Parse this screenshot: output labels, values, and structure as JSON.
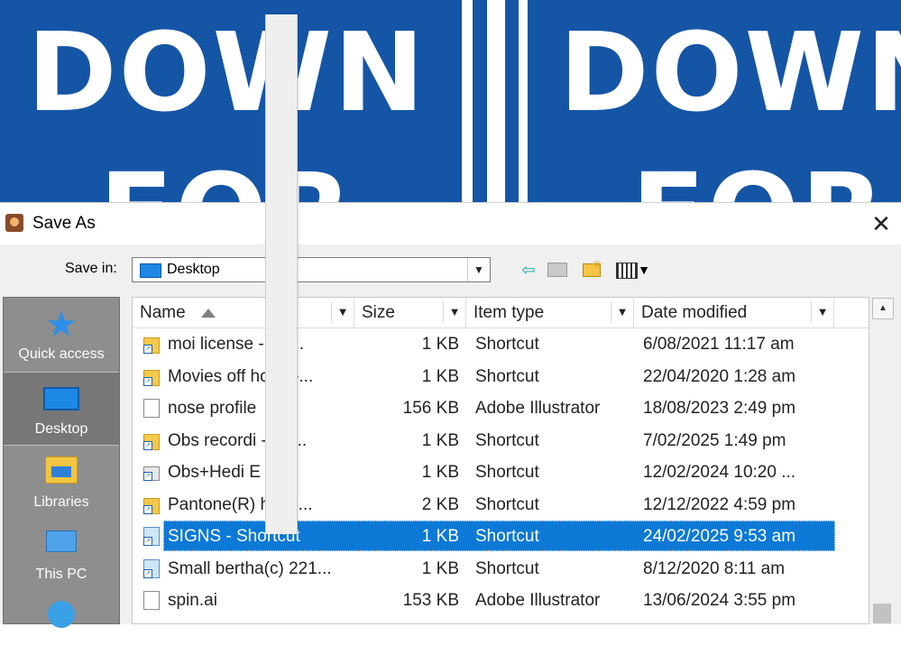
{
  "background": {
    "words": [
      "DOWN",
      "DOWN",
      "FOR",
      "FOR"
    ],
    "color": "#1555a6"
  },
  "dialog": {
    "title": "Save As",
    "close_glyph": "✕",
    "save_in_label": "Save in:",
    "save_in_value": "Desktop",
    "toolbar": {
      "back_icon": "back-arrow-icon",
      "up_icon": "up-folder-icon",
      "new_icon": "new-folder-icon",
      "view_icon": "view-menu-icon"
    }
  },
  "places": [
    {
      "label": "Quick access",
      "icon": "star-icon"
    },
    {
      "label": "Desktop",
      "icon": "desktop-icon",
      "selected": true
    },
    {
      "label": "Libraries",
      "icon": "libraries-icon"
    },
    {
      "label": "This PC",
      "icon": "computer-icon"
    },
    {
      "label": "",
      "icon": "network-icon"
    }
  ],
  "columns": [
    "Name",
    "Size",
    "Item type",
    "Date modified"
  ],
  "files": [
    {
      "name": "moi license     - Sh...",
      "size": "1 KB",
      "type": "Shortcut",
      "date": "6/08/2021 11:17 am",
      "icon": "folder"
    },
    {
      "name": "Movies off  hone -...",
      "size": "1 KB",
      "type": "Shortcut",
      "date": "22/04/2020 1:28 am",
      "icon": "folder"
    },
    {
      "name": "nose profile",
      "size": "156 KB",
      "type": "Adobe Illustrator",
      "date": "18/08/2023 2:49 pm",
      "icon": "file"
    },
    {
      "name": "Obs recordi      - Sh...",
      "size": "1 KB",
      "type": "Shortcut",
      "date": "7/02/2025 1:49 pm",
      "icon": "folder"
    },
    {
      "name": "Obs+Hedi E",
      "size": "1 KB",
      "type": "Shortcut",
      "date": "12/02/2024 10:20 ...",
      "icon": "app"
    },
    {
      "name": "Pantone(R)      hortc...",
      "size": "2 KB",
      "type": "Shortcut",
      "date": "12/12/2022 4:59 pm",
      "icon": "folder"
    },
    {
      "name": "SIGNS - Shortcut",
      "size": "1 KB",
      "type": "Shortcut",
      "date": "24/02/2025 9:53 am",
      "icon": "app2",
      "selected": true
    },
    {
      "name": "Small bertha(c) 221...",
      "size": "1 KB",
      "type": "Shortcut",
      "date": "8/12/2020 8:11 am",
      "icon": "app2"
    },
    {
      "name": "spin.ai",
      "size": "153 KB",
      "type": "Adobe Illustrator",
      "date": "13/06/2024 3:55 pm",
      "icon": "file"
    }
  ]
}
